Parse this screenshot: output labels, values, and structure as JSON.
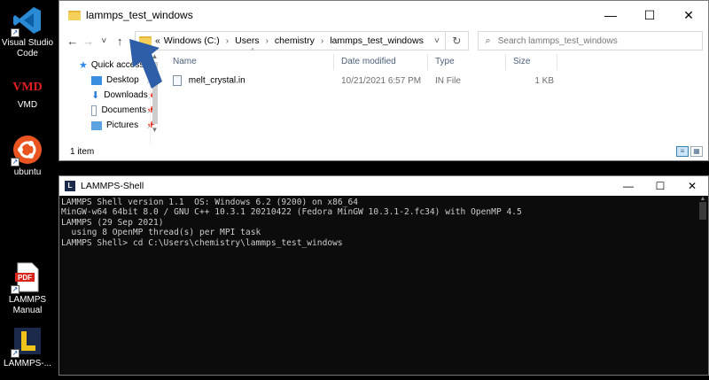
{
  "desktop": {
    "icons": [
      {
        "label": "Visual Studio Code"
      },
      {
        "label": "VMD",
        "logo": "VMD"
      },
      {
        "label": "ubuntu"
      },
      {
        "label": "LAMMPS Manual",
        "logo": "PDF"
      },
      {
        "label": "LAMMPS-..."
      }
    ]
  },
  "explorer": {
    "title": "lammps_test_windows",
    "controls": {
      "minimize": "—",
      "maximize": "☐",
      "close": "✕"
    },
    "nav": {
      "back": "←",
      "forward": "→",
      "recent": "˅",
      "up": "↑"
    },
    "address": {
      "overflow": "«",
      "crumbs": [
        "Windows (C:)",
        "Users",
        "chemistry",
        "lammps_test_windows"
      ],
      "separator": "›",
      "dropdown": "˅"
    },
    "refresh_icon": "↻",
    "search": {
      "placeholder": "Search lammps_test_windows",
      "icon": "⌕"
    },
    "nav_pane": [
      {
        "label": "Quick access",
        "icon": "star-icon",
        "color": "#2e8ae6"
      },
      {
        "label": "Desktop",
        "icon": "desktop-icon",
        "color": "#3a8ee0"
      },
      {
        "label": "Downloads",
        "icon": "download-icon",
        "color": "#2f7fd8"
      },
      {
        "label": "Documents",
        "icon": "documents-icon",
        "color": "#8aa0b8"
      },
      {
        "label": "Pictures",
        "icon": "pictures-icon",
        "color": "#5aa3e0"
      }
    ],
    "columns": [
      "Name",
      "Date modified",
      "Type",
      "Size"
    ],
    "files": [
      {
        "name": "melt_crystal.in",
        "date": "10/21/2021 6:57 PM",
        "type": "IN File",
        "size": "1 KB"
      }
    ],
    "status": "1 item"
  },
  "shell": {
    "title": "LAMMPS-Shell",
    "logo": "L",
    "controls": {
      "minimize": "—",
      "maximize": "☐",
      "close": "✕"
    },
    "lines": [
      "LAMMPS Shell version 1.1  OS: Windows 6.2 (9200) on x86_64",
      "MinGW-w64 64bit 8.0 / GNU C++ 10.3.1 20210422 (Fedora MinGW 10.3.1-2.fc34) with OpenMP 4.5",
      "LAMMPS (29 Sep 2021)",
      "  using 8 OpenMP thread(s) per MPI task",
      "LAMMPS Shell> cd C:\\Users\\chemistry\\lammps_test_windows"
    ]
  },
  "colors": {
    "annotation_arrow": "#2f5ea8",
    "folder": "#f4cf5a"
  }
}
